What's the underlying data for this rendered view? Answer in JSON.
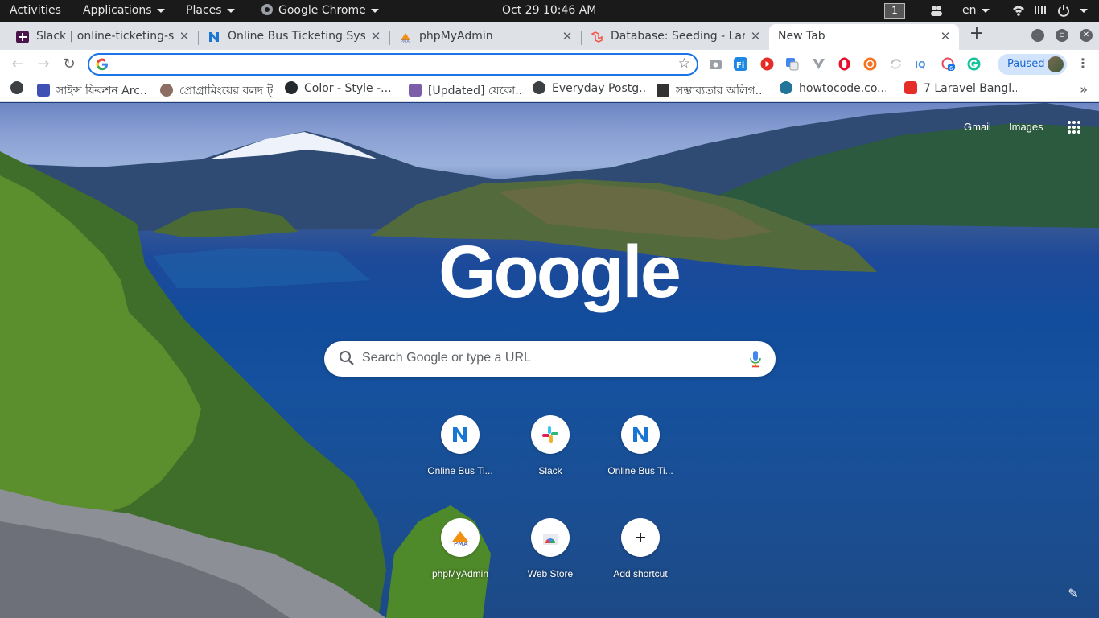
{
  "topbar": {
    "activities": "Activities",
    "applications": "Applications",
    "places": "Places",
    "app_name": "Google Chrome",
    "clock": "Oct 29  10:46 AM",
    "workspace": "1",
    "language": "en",
    "icons": [
      "people-icon",
      "wifi-icon",
      "volume-icon",
      "power-icon"
    ]
  },
  "tabs": [
    {
      "title": "Slack | online-ticketing-sy",
      "favicon": "slack-icon",
      "active": false
    },
    {
      "title": "Online Bus Ticketing Syste",
      "favicon": "n-logo-icon",
      "active": false
    },
    {
      "title": "phpMyAdmin",
      "favicon": "pma-icon",
      "active": false
    },
    {
      "title": "Database: Seeding - Lara",
      "favicon": "laravel-icon",
      "active": false
    },
    {
      "title": "New Tab",
      "favicon": "",
      "active": true
    }
  ],
  "toolbar": {
    "address_value": "",
    "profile_label": "Paused",
    "extensions": [
      "camera-icon",
      "fi-icon",
      "youtube-icon",
      "translate-icon",
      "vue-icon",
      "opera-icon",
      "ubuntu-icon",
      "refresh-ext-icon",
      "iq-icon",
      "badge-ext-icon",
      "grammarly-icon"
    ],
    "extension_badge": "6"
  },
  "bookmarks": [
    {
      "label": "",
      "icon": "globe-icon"
    },
    {
      "label": "সাইন্স ফিকশন Arc...",
      "icon": "puzzle-icon"
    },
    {
      "label": "প্রোগ্রামিংয়ের বলদ ট্...",
      "icon": "face-icon"
    },
    {
      "label": "Color - Style -...",
      "icon": "github-icon"
    },
    {
      "label": "[Updated] যেকো...",
      "icon": "image-icon"
    },
    {
      "label": "Everyday Postg...",
      "icon": "globe-icon"
    },
    {
      "label": "সম্ভাব্যতার অলিগ...",
      "icon": "10-icon"
    },
    {
      "label": "howtocode.co...",
      "icon": "wordpress-icon"
    },
    {
      "label": "7 Laravel Bangl...",
      "icon": "youtube-icon"
    }
  ],
  "ntp": {
    "gmail": "Gmail",
    "images": "Images",
    "logo": "Google",
    "search_placeholder": "Search Google or type a URL",
    "shortcuts": [
      {
        "title": "Online Bus Ti...",
        "icon": "n-logo-icon"
      },
      {
        "title": "Slack",
        "icon": "slack-icon"
      },
      {
        "title": "Online Bus Ti...",
        "icon": "n-logo-icon"
      },
      {
        "title": "phpMyAdmin",
        "icon": "pma-icon"
      },
      {
        "title": "Web Store",
        "icon": "webstore-icon"
      },
      {
        "title": "Add shortcut",
        "icon": "plus-icon"
      }
    ]
  },
  "colors": {
    "accent": "#1a73e8",
    "tabstrip": "#dee1e6",
    "topbar": "#1a1a1a"
  }
}
